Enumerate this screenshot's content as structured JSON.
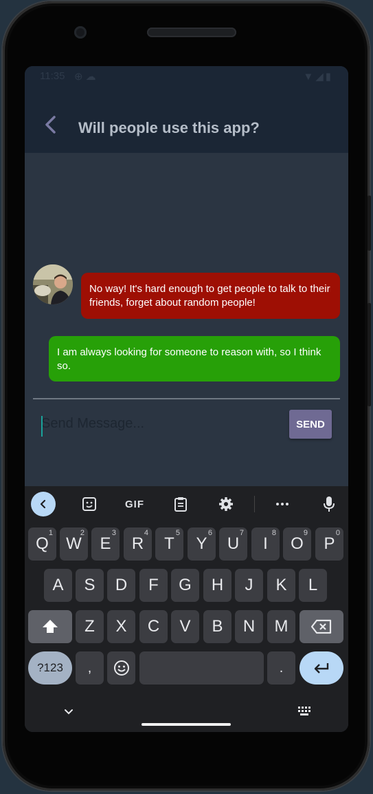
{
  "status_bar": {
    "time": "11:35",
    "left_icons": [
      "vpn-icon",
      "cloud-icon"
    ],
    "right_icons": [
      "wifi-icon",
      "signal-icon",
      "battery-icon"
    ]
  },
  "app_bar": {
    "title": "Will people use this app?"
  },
  "messages": [
    {
      "sender": "other",
      "color": "#9e0f04",
      "text": "No way! It's hard enough to get people to talk to their friends, forget about random people!"
    },
    {
      "sender": "me",
      "color": "#27a008",
      "text": "I am always looking for someone to reason with, so I think so."
    }
  ],
  "composer": {
    "placeholder": "Send Message...",
    "send_label": "SEND",
    "send_color": "#6f6a93"
  },
  "keyboard": {
    "toolbar": {
      "gif_label": "GIF",
      "icons": [
        "collapse-icon",
        "sticker-icon",
        "gif-icon",
        "clipboard-icon",
        "settings-icon",
        "more-icon",
        "mic-icon"
      ]
    },
    "row1": [
      {
        "key": "Q",
        "hint": "1"
      },
      {
        "key": "W",
        "hint": "2"
      },
      {
        "key": "E",
        "hint": "3"
      },
      {
        "key": "R",
        "hint": "4"
      },
      {
        "key": "T",
        "hint": "5"
      },
      {
        "key": "Y",
        "hint": "6"
      },
      {
        "key": "U",
        "hint": "7"
      },
      {
        "key": "I",
        "hint": "8"
      },
      {
        "key": "O",
        "hint": "9"
      },
      {
        "key": "P",
        "hint": "0"
      }
    ],
    "row2": [
      "A",
      "S",
      "D",
      "F",
      "G",
      "H",
      "J",
      "K",
      "L"
    ],
    "row3": [
      "Z",
      "X",
      "C",
      "V",
      "B",
      "N",
      "M"
    ],
    "row4": {
      "symbols": "?123",
      "comma": ",",
      "period": "."
    },
    "accent_color": "#b8d8f6"
  }
}
